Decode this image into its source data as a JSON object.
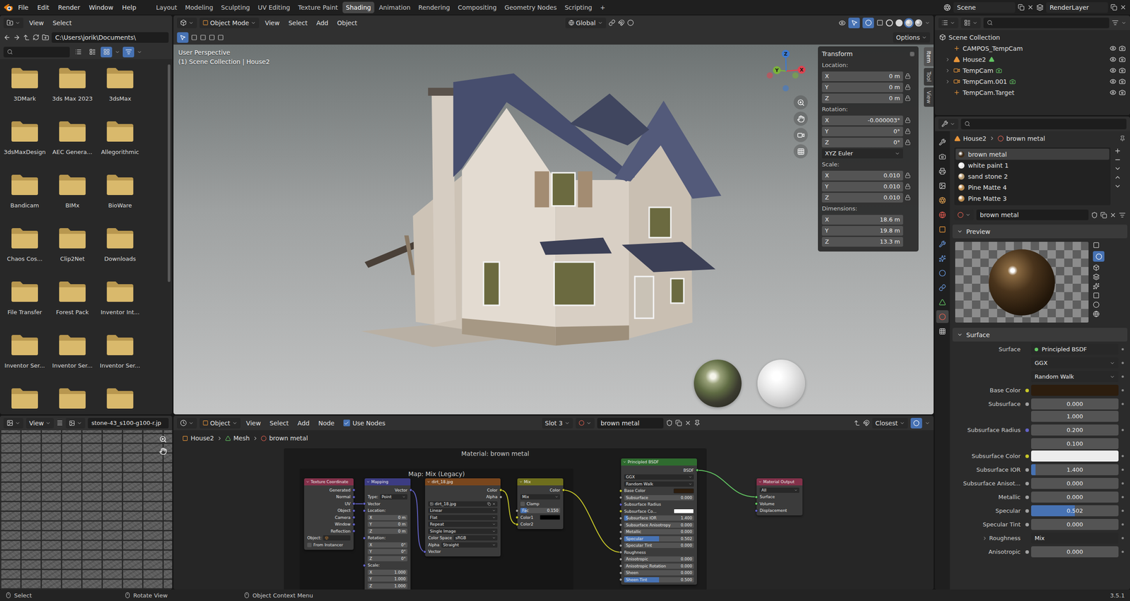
{
  "top_bar": {
    "menus": [
      "File",
      "Edit",
      "Render",
      "Window",
      "Help"
    ],
    "workspaces": [
      {
        "label": "Layout",
        "selected": false
      },
      {
        "label": "Modeling",
        "selected": false
      },
      {
        "label": "Sculpting",
        "selected": false
      },
      {
        "label": "UV Editing",
        "selected": false
      },
      {
        "label": "Texture Paint",
        "selected": false
      },
      {
        "label": "Shading",
        "selected": true
      },
      {
        "label": "Animation",
        "selected": false
      },
      {
        "label": "Rendering",
        "selected": false
      },
      {
        "label": "Compositing",
        "selected": false
      },
      {
        "label": "Geometry Nodes",
        "selected": false
      },
      {
        "label": "Scripting",
        "selected": false
      }
    ],
    "add_workspace": "+",
    "scene": "Scene",
    "view_layer": "RenderLayer"
  },
  "file_browser": {
    "menus": [
      "View",
      "Select"
    ],
    "path": "C:\\Users\\jorik\\Documents\\",
    "search_placeholder": "",
    "display_modes": [
      {
        "kind": "vertical",
        "selected": false
      },
      {
        "kind": "horizontal",
        "selected": false
      },
      {
        "kind": "thumbnails",
        "selected": true
      }
    ],
    "filter_active": true,
    "folders": [
      {
        "label": "3DMark"
      },
      {
        "label": "3ds Max 2023"
      },
      {
        "label": "3dsMax"
      },
      {
        "label": "3dsMaxDesign"
      },
      {
        "label": "AEC Genera..."
      },
      {
        "label": "Allegorithmic"
      },
      {
        "label": "Bandicam"
      },
      {
        "label": "BIMx"
      },
      {
        "label": "BioWare"
      },
      {
        "label": "Chaos Cos..."
      },
      {
        "label": "Clip2Net"
      },
      {
        "label": "Downloads"
      },
      {
        "label": "File Transfer"
      },
      {
        "label": "Forest Pack"
      },
      {
        "label": "Inventor Int..."
      },
      {
        "label": "Inventor Ser..."
      },
      {
        "label": "Inventor Ser..."
      },
      {
        "label": "Inventor Ser..."
      },
      {
        "label": ""
      },
      {
        "label": ""
      },
      {
        "label": ""
      }
    ]
  },
  "image_editor": {
    "menus": [
      "View"
    ],
    "image": "stone-43_s100-g100-r.jp"
  },
  "viewport": {
    "mode": "Object Mode",
    "menus": [
      "View",
      "Select",
      "Add",
      "Object"
    ],
    "orientation": "Global",
    "options": "Options",
    "info": [
      "User Perspective",
      "(1) Scene Collection | House2"
    ],
    "side_tabs": [
      {
        "label": "Item",
        "selected": true
      },
      {
        "label": "Tool",
        "selected": false
      },
      {
        "label": "View",
        "selected": false
      }
    ],
    "axes": [
      {
        "label": "X",
        "color": "#e0424f"
      },
      {
        "label": "Y",
        "color": "#7bb33a"
      },
      {
        "label": "Z",
        "color": "#3d7ad1"
      }
    ],
    "shading": [
      {
        "kind": "wire",
        "selected": false
      },
      {
        "kind": "solid",
        "selected": false
      },
      {
        "kind": "material",
        "selected": true
      },
      {
        "kind": "rendered",
        "selected": false
      }
    ],
    "transform": {
      "title": "Transform",
      "groups": [
        {
          "label": "Location:",
          "lock": true,
          "rows": [
            {
              "axis": "X",
              "value": "0 m"
            },
            {
              "axis": "Y",
              "value": "0 m"
            },
            {
              "axis": "Z",
              "value": "0 m"
            }
          ]
        },
        {
          "label": "Rotation:",
          "lock": true,
          "rows": [
            {
              "axis": "X",
              "value": "-0.000003°"
            },
            {
              "axis": "Y",
              "value": "0°"
            },
            {
              "axis": "Z",
              "value": "0°"
            }
          ],
          "mode": "XYZ Euler"
        },
        {
          "label": "Scale:",
          "lock": true,
          "rows": [
            {
              "axis": "X",
              "value": "0.010"
            },
            {
              "axis": "Y",
              "value": "0.010"
            },
            {
              "axis": "Z",
              "value": "0.010"
            }
          ]
        },
        {
          "label": "Dimensions:",
          "lock": false,
          "rows": [
            {
              "axis": "X",
              "value": "18.6 m"
            },
            {
              "axis": "Y",
              "value": "19.8 m"
            },
            {
              "axis": "Z",
              "value": "13.3 m"
            }
          ]
        }
      ]
    }
  },
  "outliner": {
    "root": "Scene Collection",
    "items": [
      {
        "label": "CAMPOS_TempCam",
        "kind": "empty",
        "expandable": false,
        "expanded": false,
        "visible": true,
        "renderable": true
      },
      {
        "label": "House2",
        "kind": "mesh",
        "expandable": true,
        "expanded": false,
        "visible": true,
        "renderable": true
      },
      {
        "label": "TempCam",
        "kind": "camera",
        "expandable": true,
        "expanded": false,
        "visible": true,
        "renderable": true
      },
      {
        "label": "TempCam.001",
        "kind": "camera",
        "expandable": true,
        "expanded": false,
        "visible": true,
        "renderable": true
      },
      {
        "label": "TempCam.Target",
        "kind": "empty",
        "expandable": false,
        "expanded": false,
        "visible": true,
        "renderable": true
      }
    ]
  },
  "properties": {
    "tabs": [
      {
        "kind": "tool",
        "selected": false
      },
      {
        "kind": "render",
        "selected": false
      },
      {
        "kind": "output",
        "selected": false
      },
      {
        "kind": "view_layer",
        "selected": false
      },
      {
        "kind": "scene",
        "selected": false
      },
      {
        "kind": "world",
        "selected": false
      },
      {
        "kind": "object",
        "selected": false
      },
      {
        "kind": "modifiers",
        "selected": false
      },
      {
        "kind": "particles",
        "selected": false
      },
      {
        "kind": "physics",
        "selected": false
      },
      {
        "kind": "constraints",
        "selected": false
      },
      {
        "kind": "data",
        "selected": false
      },
      {
        "kind": "material",
        "selected": true
      },
      {
        "kind": "texture",
        "selected": false
      }
    ],
    "breadcrumb": [
      "House2",
      "brown metal"
    ],
    "slots": [
      {
        "label": "brown metal",
        "selected": true,
        "color": "#3b2a18"
      },
      {
        "label": "white paint 1",
        "selected": false,
        "color": "#e8e8e8"
      },
      {
        "label": "sand stone 2",
        "selected": false,
        "color": "#b59a72"
      },
      {
        "label": "Pine Matte 4",
        "selected": false,
        "color": "#b98a4e"
      },
      {
        "label": "Pine Matte 3",
        "selected": false,
        "color": "#b98a4e"
      }
    ],
    "material": "brown metal",
    "panels": [
      {
        "label": "Preview",
        "expanded": true
      },
      {
        "label": "Surface",
        "expanded": true
      }
    ],
    "surface_rows": [
      {
        "kind": "link",
        "label": "Surface",
        "value": "Principled BSDF",
        "color": "#63c763"
      },
      {
        "kind": "dropdown",
        "label": "",
        "value": "GGX"
      },
      {
        "kind": "dropdown",
        "label": "",
        "value": "Random Walk"
      },
      {
        "kind": "swatch",
        "label": "Base Color",
        "color": "#c7c729",
        "swatch": "#2c1d0e"
      },
      {
        "kind": "number",
        "label": "Subsurface",
        "value": "0.000",
        "color": "#a1a1a1",
        "level": 0
      },
      {
        "kind": "vector",
        "label": "Subsurface Radius",
        "values": [
          "1.000",
          "0.200",
          "0.100"
        ],
        "color": "#6363c7"
      },
      {
        "kind": "swatch",
        "label": "Subsurface Color",
        "color": "#c7c729",
        "swatch": "#ececec"
      },
      {
        "kind": "number",
        "label": "Subsurface IOR",
        "value": "1.400",
        "color": "#a1a1a1",
        "level": 0.05
      },
      {
        "kind": "number",
        "label": "Subsurface Anisot...",
        "value": "0.000",
        "color": "#a1a1a1",
        "level": 0
      },
      {
        "kind": "number",
        "label": "Metallic",
        "value": "0.000",
        "color": "#a1a1a1",
        "level": 0
      },
      {
        "kind": "number",
        "label": "Specular",
        "value": "0.502",
        "color": "#a1a1a1",
        "level": 0.502
      },
      {
        "kind": "number",
        "label": "Specular Tint",
        "value": "0.000",
        "color": "#a1a1a1",
        "level": 0
      },
      {
        "kind": "linked",
        "label": "Roughness",
        "value": "Mix",
        "expanded": false
      },
      {
        "kind": "number",
        "label": "Anisotropic",
        "value": "0.000",
        "color": "#a1a1a1",
        "level": 0
      }
    ]
  },
  "node_editor": {
    "editor_mode": "Object",
    "menus": [
      "View",
      "Select",
      "Add",
      "Node"
    ],
    "use_nodes": {
      "label": "Use Nodes",
      "checked": true
    },
    "slot": "Slot 3",
    "material": "brown metal",
    "interpolation": "Closest",
    "breadcrumb": [
      "House2",
      "Mesh",
      "brown metal"
    ],
    "frames": [
      {
        "label": "Material: brown metal"
      },
      {
        "label": "Map: Mix (Legacy)"
      }
    ],
    "nodes": [
      {
        "title": "Texture Coordinate",
        "color": "#83314a",
        "rows": [
          {
            "kind": "output",
            "label": "Generated",
            "color": "#6363c7"
          },
          {
            "kind": "output",
            "label": "Normal",
            "color": "#6363c7"
          },
          {
            "kind": "output",
            "label": "UV",
            "color": "#6363c7"
          },
          {
            "kind": "output",
            "label": "Object",
            "color": "#6363c7"
          },
          {
            "kind": "output",
            "label": "Camera",
            "color": "#6363c7"
          },
          {
            "kind": "output",
            "label": "Window",
            "color": "#6363c7"
          },
          {
            "kind": "output",
            "label": "Reflection",
            "color": "#6363c7"
          },
          {
            "kind": "field",
            "label": "Object:"
          },
          {
            "kind": "check",
            "label": "From Instancer",
            "checked": false
          }
        ]
      },
      {
        "title": "Mapping",
        "color": "#3c3c83",
        "rows": [
          {
            "kind": "output",
            "label": "Vector",
            "color": "#6363c7"
          },
          {
            "kind": "dropdown",
            "label": "Type:",
            "value": "Point"
          },
          {
            "kind": "input",
            "label": "Vector",
            "color": "#6363c7"
          },
          {
            "kind": "input",
            "label": "Location:",
            "color": "#6363c7"
          },
          {
            "kind": "value",
            "label": "X",
            "value": "0 m"
          },
          {
            "kind": "value",
            "label": "Y",
            "value": "0 m"
          },
          {
            "kind": "value",
            "label": "Z",
            "value": "0 m"
          },
          {
            "kind": "input",
            "label": "Rotation:",
            "color": "#6363c7"
          },
          {
            "kind": "value",
            "label": "X",
            "value": "0°"
          },
          {
            "kind": "value",
            "label": "Y",
            "value": "0°"
          },
          {
            "kind": "value",
            "label": "Z",
            "value": "0°"
          },
          {
            "kind": "input",
            "label": "Scale:",
            "color": "#6363c7"
          },
          {
            "kind": "value",
            "label": "X",
            "value": "1.000"
          },
          {
            "kind": "value",
            "label": "Y",
            "value": "1.000"
          },
          {
            "kind": "value",
            "label": "Z",
            "value": "1.000"
          }
        ]
      },
      {
        "title": "dirt_18.jpg",
        "color": "#79461d",
        "rows": [
          {
            "kind": "output",
            "label": "Color",
            "color": "#c7c729"
          },
          {
            "kind": "output",
            "label": "Alpha",
            "color": "#a1a1a1"
          },
          {
            "kind": "image",
            "label": "dirt_18.jpg"
          },
          {
            "kind": "dropdown",
            "label": "",
            "value": "Linear"
          },
          {
            "kind": "dropdown",
            "label": "",
            "value": "Flat"
          },
          {
            "kind": "dropdown",
            "label": "",
            "value": "Repeat"
          },
          {
            "kind": "dropdown",
            "label": "",
            "value": "Single Image"
          },
          {
            "kind": "dropdown",
            "label": "Color Space",
            "value": "sRGB"
          },
          {
            "kind": "dropdown",
            "label": "Alpha",
            "value": "Straight"
          },
          {
            "kind": "input",
            "label": "Vector",
            "color": "#6363c7"
          }
        ]
      },
      {
        "title": "Mix",
        "color": "#6e6e1d",
        "rows": [
          {
            "kind": "output",
            "label": "Color",
            "color": "#c7c729"
          },
          {
            "kind": "dropdown",
            "label": "",
            "value": "Mix"
          },
          {
            "kind": "check",
            "label": "Clamp",
            "checked": false
          },
          {
            "kind": "value",
            "label": "Fac",
            "value": "0.150",
            "color": "#a1a1a1",
            "level": 0.15
          },
          {
            "kind": "swatch",
            "label": "Color1",
            "color": "#c7c729",
            "swatch": "#000000"
          },
          {
            "kind": "input",
            "label": "Color2",
            "color": "#c7c729"
          }
        ]
      },
      {
        "title": "Principled BSDF",
        "color": "#2f6b2f",
        "rows": [
          {
            "kind": "output",
            "label": "BSDF",
            "color": "#63c763"
          },
          {
            "kind": "dropdown",
            "label": "",
            "value": "GGX"
          },
          {
            "kind": "dropdown",
            "label": "",
            "value": "Random Walk"
          },
          {
            "kind": "swatch",
            "label": "Base Color",
            "color": "#c7c729",
            "swatch": "#2c1d0e"
          },
          {
            "kind": "value",
            "label": "Subsurface",
            "value": "0.000",
            "color": "#a1a1a1",
            "level": 0
          },
          {
            "kind": "input",
            "label": "Subsurface Radius",
            "color": "#6363c7"
          },
          {
            "kind": "swatch",
            "label": "Subsurface Co...",
            "color": "#c7c729",
            "swatch": "#ffffff"
          },
          {
            "kind": "value",
            "label": "Subsurface IOR",
            "value": "1.400",
            "color": "#a1a1a1",
            "level": 0.05
          },
          {
            "kind": "value",
            "label": "Subsurface Anisotropy",
            "value": "0.000",
            "color": "#a1a1a1",
            "level": 0
          },
          {
            "kind": "value",
            "label": "Metallic",
            "value": "0.000",
            "color": "#a1a1a1",
            "level": 0
          },
          {
            "kind": "value",
            "label": "Specular",
            "value": "0.502",
            "color": "#a1a1a1",
            "level": 0.502
          },
          {
            "kind": "value",
            "label": "Specular Tint",
            "value": "0.000",
            "color": "#a1a1a1",
            "level": 0
          },
          {
            "kind": "input",
            "label": "Roughness",
            "color": "#a1a1a1"
          },
          {
            "kind": "value",
            "label": "Anisotropic",
            "value": "0.000",
            "color": "#a1a1a1",
            "level": 0
          },
          {
            "kind": "value",
            "label": "Anisotropic Rotation",
            "value": "0.000",
            "color": "#a1a1a1",
            "level": 0
          },
          {
            "kind": "value",
            "label": "Sheen",
            "value": "0.000",
            "color": "#a1a1a1",
            "level": 0
          },
          {
            "kind": "value",
            "label": "Sheen Tint",
            "value": "0.500",
            "color": "#a1a1a1",
            "level": 0.5
          }
        ]
      },
      {
        "title": "Material Output",
        "color": "#83314a",
        "rows": [
          {
            "kind": "dropdown",
            "label": "",
            "value": "All"
          },
          {
            "kind": "input",
            "label": "Surface",
            "color": "#63c763"
          },
          {
            "kind": "input",
            "label": "Volume",
            "color": "#63c763"
          },
          {
            "kind": "input",
            "label": "Displacement",
            "color": "#6363c7"
          }
        ]
      }
    ]
  },
  "status_bar": {
    "items": [
      "Select",
      "Rotate View",
      "Object Context Menu"
    ],
    "version": "3.5.1"
  }
}
